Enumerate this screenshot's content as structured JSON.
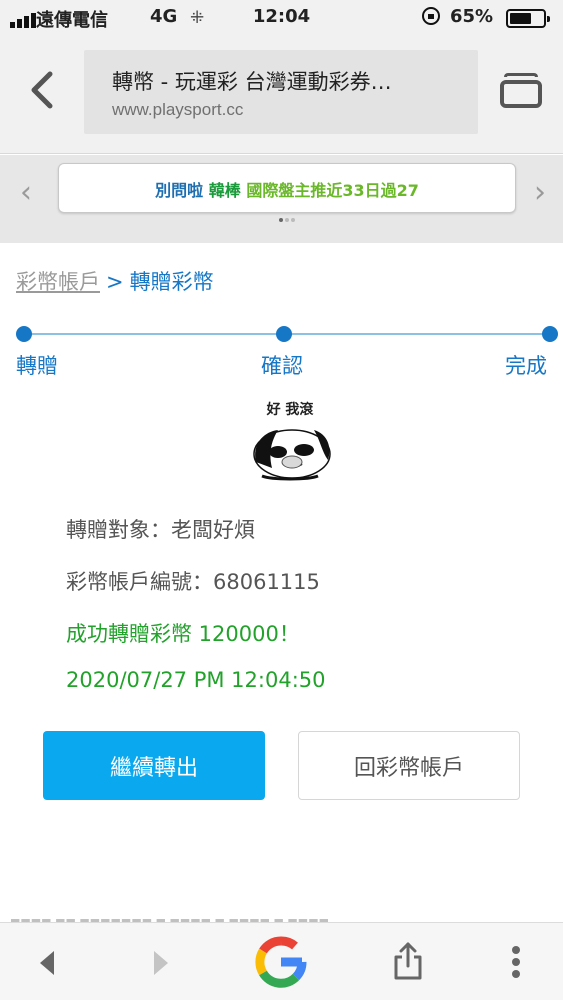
{
  "status_bar": {
    "carrier": "遠傳電信",
    "network": "4G",
    "time": "12:04",
    "battery_percent": "65%",
    "battery_level": 0.65
  },
  "browser": {
    "page_title": "轉幣 - 玩運彩 台灣運動彩券…",
    "domain": "www.playsport.cc"
  },
  "ticker": {
    "part1": "別問啦",
    "part2": "韓棒",
    "part3": "國際盤主推近33日過27"
  },
  "breadcrumb": {
    "root": "彩幣帳戶",
    "separator": ">",
    "current": "轉贈彩幣"
  },
  "steps": [
    {
      "label": "轉贈"
    },
    {
      "label": "確認"
    },
    {
      "label": "完成"
    }
  ],
  "sticker": {
    "caption": "好 我滾"
  },
  "result": {
    "recipient": "轉贈對象：老闆好煩",
    "account_no": "彩幣帳戶編號：68061115",
    "success_msg": "成功轉贈彩幣 120000！",
    "datetime": "2020/07/27 PM 12:04:50"
  },
  "buttons": {
    "continue": "繼續轉出",
    "back_to_account": "回彩幣帳戶"
  },
  "colors": {
    "accent_blue": "#1677c7",
    "button_blue": "#0aa8ef",
    "success_green": "#22a22b"
  }
}
